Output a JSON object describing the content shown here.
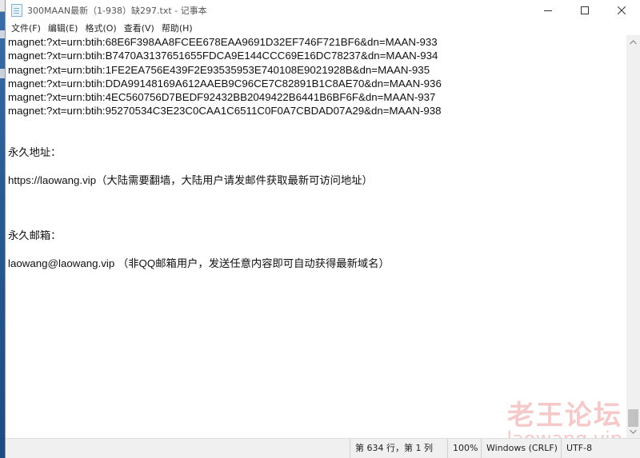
{
  "window": {
    "title": "300MAAN最新（1-938）缺297.txt - 记事本",
    "minimize_label": "minimize",
    "maximize_label": "maximize",
    "close_label": "close"
  },
  "menu": {
    "items": [
      {
        "label": "文件(F)"
      },
      {
        "label": "编辑(E)"
      },
      {
        "label": "格式(O)"
      },
      {
        "label": "查看(V)"
      },
      {
        "label": "帮助(H)"
      }
    ]
  },
  "editor": {
    "lines": [
      "magnet:?xt=urn:btih:68E6F398AA8FCEE678EAA9691D32EF746F721BF6&dn=MAAN-933",
      "magnet:?xt=urn:btih:B7470A3137651655FDCA9E144CCC69E16DC78237&dn=MAAN-934",
      "magnet:?xt=urn:btih:1FE2EA756E439F2E93535953E740108E9021928B&dn=MAAN-935",
      "magnet:?xt=urn:btih:DDA99148169A612AAEB9C96CE7C82891B1C8AE70&dn=MAAN-936",
      "magnet:?xt=urn:btih:4EC560756D7BEDF92432BB2049422B6441B6BF6F&dn=MAAN-937",
      "magnet:?xt=urn:btih:95270534C3E23C0CAA1C6511C0F0A7CBDAD07A29&dn=MAAN-938",
      "",
      "",
      "永久地址：",
      "",
      "https://laowang.vip（大陆需要翻墙，大陆用户请发邮件获取最新可访问地址）",
      "",
      "",
      "",
      "永久邮箱：",
      "",
      "laowang@laowang.vip （非QQ邮箱用户，发送任意内容即可自动获得最新域名）"
    ]
  },
  "statusbar": {
    "position": "第 634 行，第 1 列",
    "zoom": "100%",
    "line_ending": "Windows (CRLF)",
    "encoding": "UTF-8"
  },
  "watermark": {
    "text": "老王论坛",
    "url": "laowang.vip"
  }
}
